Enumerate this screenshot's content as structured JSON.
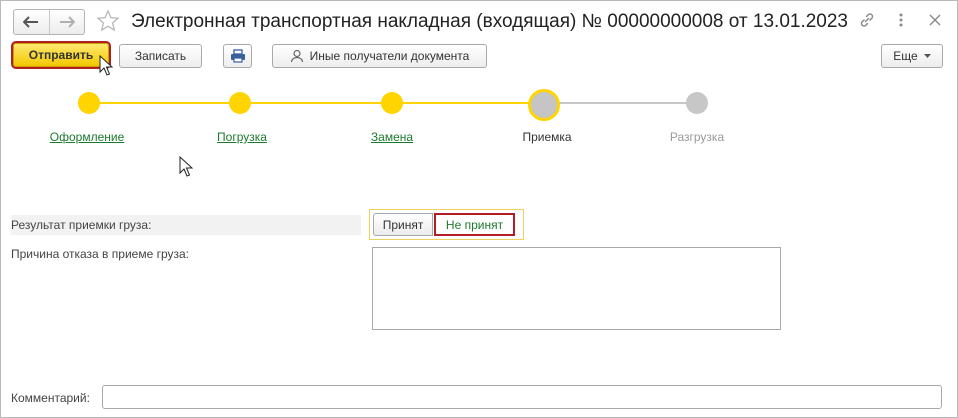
{
  "title": "Электронная транспортная накладная (входящая) № 00000000008 от 13.01.2023",
  "toolbar": {
    "send_label": "Отправить",
    "save_label": "Записать",
    "recipients_label": "Иные получатели документа",
    "more_label": "Еще"
  },
  "steps": [
    {
      "label": "Оформление",
      "state": "done"
    },
    {
      "label": "Погрузка",
      "state": "done"
    },
    {
      "label": "Замена",
      "state": "done"
    },
    {
      "label": "Приемка",
      "state": "current"
    },
    {
      "label": "Разгрузка",
      "state": "todo"
    }
  ],
  "form": {
    "result_label": "Результат приемки груза:",
    "accept_label": "Принят",
    "reject_label": "Не принят",
    "reason_label": "Причина отказа в приеме груза:",
    "reason_value": "",
    "comment_label": "Комментарий:",
    "comment_value": ""
  },
  "colors": {
    "accent": "#ffd400",
    "highlight": "#b21e24",
    "link": "#1d7a2d"
  }
}
